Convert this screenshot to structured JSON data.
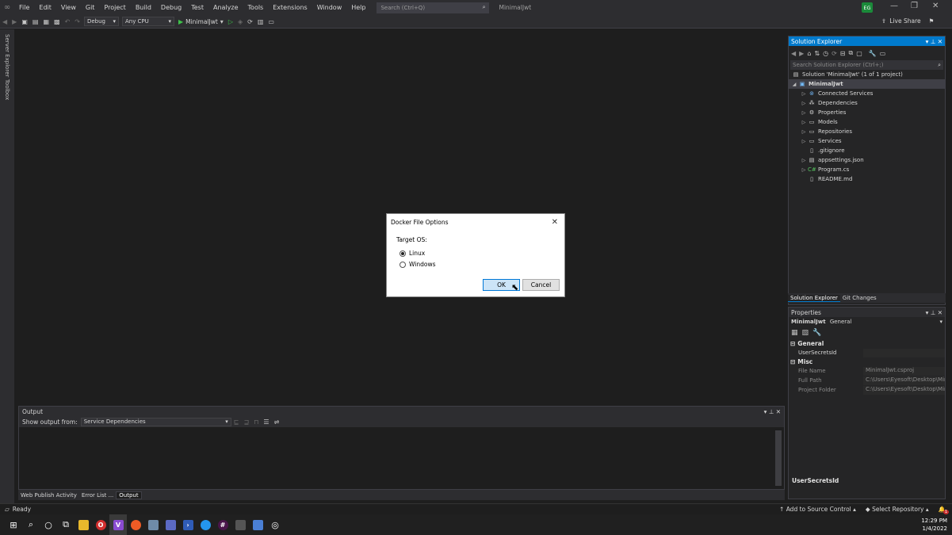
{
  "menubar": {
    "items": [
      "File",
      "Edit",
      "View",
      "Git",
      "Project",
      "Build",
      "Debug",
      "Test",
      "Analyze",
      "Tools",
      "Extensions",
      "Window",
      "Help"
    ],
    "search_placeholder": "Search (Ctrl+Q)",
    "app_title": "MinimalJwt",
    "user_initials": "EG"
  },
  "toolbar": {
    "config": "Debug",
    "platform": "Any CPU",
    "run_target": "MinimalJwt",
    "liveshare": "Live Share"
  },
  "left_tabs": [
    "Server Explorer",
    "Toolbox"
  ],
  "output": {
    "title": "Output",
    "show_from_label": "Show output from:",
    "source": "Service Dependencies",
    "pin": "▾ ⊥ ✕"
  },
  "bottom_tabs": [
    "Web Publish Activity",
    "Error List ...",
    "Output"
  ],
  "solution_explorer": {
    "title": "Solution Explorer",
    "search_placeholder": "Search Solution Explorer (Ctrl+;)",
    "solution": "Solution 'MinimalJwt' (1 of 1 project)",
    "project": "MinimalJwt",
    "items": [
      {
        "label": "Connected Services",
        "icon": "connected-services-icon"
      },
      {
        "label": "Dependencies",
        "icon": "dependencies-icon"
      },
      {
        "label": "Properties",
        "icon": "properties-icon"
      },
      {
        "label": "Models",
        "icon": "folder-icon"
      },
      {
        "label": "Repositories",
        "icon": "folder-icon"
      },
      {
        "label": "Services",
        "icon": "folder-icon"
      },
      {
        "label": ".gitignore",
        "icon": "file-icon"
      },
      {
        "label": "appsettings.json",
        "icon": "json-file-icon"
      },
      {
        "label": "Program.cs",
        "icon": "csharp-file-icon"
      },
      {
        "label": "README.md",
        "icon": "markdown-file-icon"
      }
    ],
    "tabs": [
      "Solution Explorer",
      "Git Changes"
    ]
  },
  "properties": {
    "title": "Properties",
    "object": "MinimalJwt",
    "object_type": "General",
    "categories": [
      {
        "name": "General",
        "rows": [
          {
            "name": "UserSecretsId",
            "value": ""
          }
        ]
      },
      {
        "name": "Misc",
        "rows": [
          {
            "name": "File Name",
            "value": "MinimalJwt.csproj"
          },
          {
            "name": "Full Path",
            "value": "C:\\Users\\Eyesoft\\Desktop\\Min"
          },
          {
            "name": "Project Folder",
            "value": "C:\\Users\\Eyesoft\\Desktop\\Min"
          }
        ]
      }
    ],
    "description": "UserSecretsId"
  },
  "statusbar": {
    "status": "Ready",
    "source_control": "Add to Source Control",
    "repository": "Select Repository",
    "notification_count": "1"
  },
  "taskbar": {
    "time": "12:29 PM",
    "date": "1/4/2022"
  },
  "dialog": {
    "title": "Docker File Options",
    "label": "Target OS:",
    "options": [
      "Linux",
      "Windows"
    ],
    "selected": "Linux",
    "ok": "OK",
    "cancel": "Cancel"
  },
  "colors": {
    "accent": "#007acc",
    "run_green": "#3ec14a",
    "ok_button_bg": "#cce4f7"
  }
}
